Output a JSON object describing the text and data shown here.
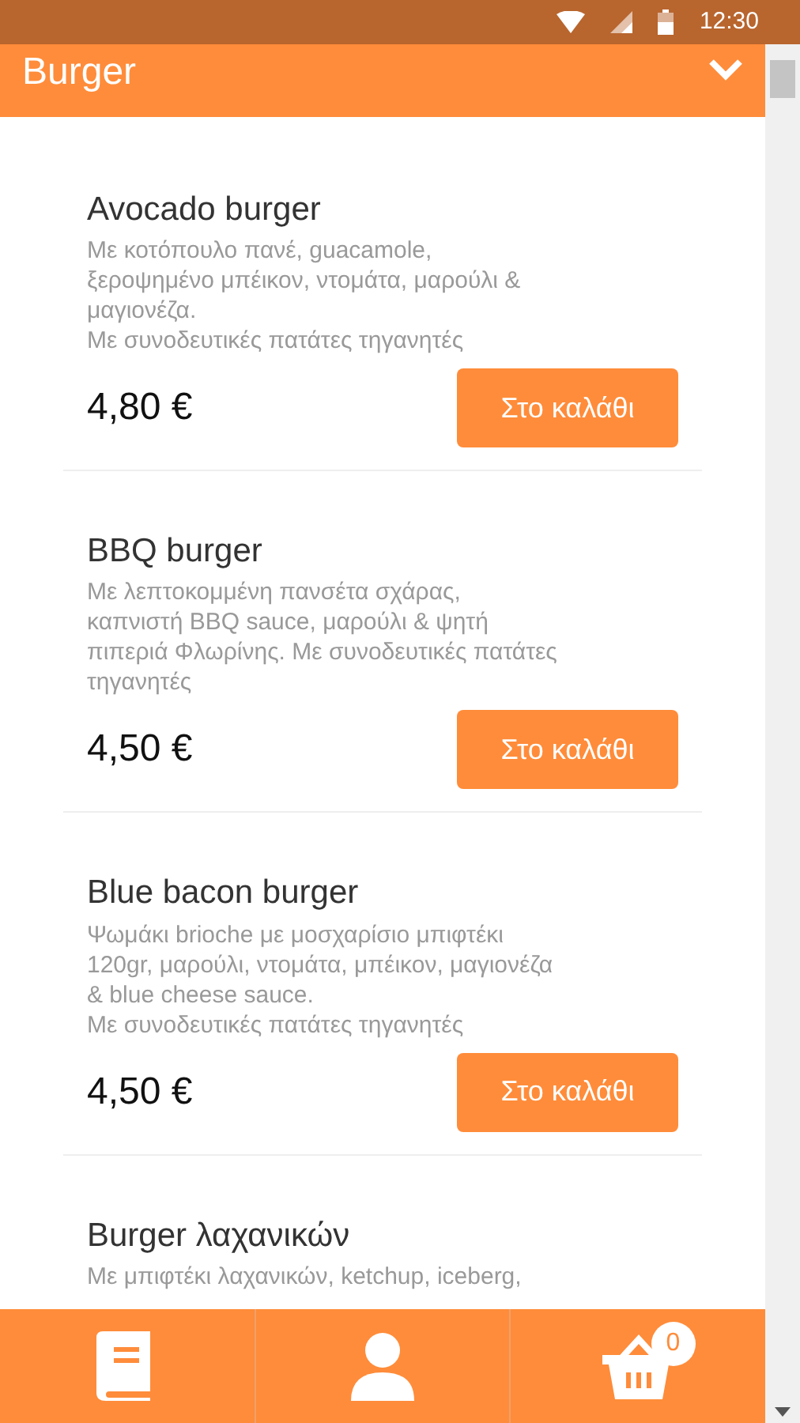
{
  "status_bar": {
    "time": "12:30"
  },
  "header": {
    "title": "Burger",
    "expanded": false
  },
  "items": [
    {
      "name": "Avocado burger",
      "description": "Με κοτόπουλο πανέ, guacamole, ξεροψημένο μπέικον, ντομάτα, μαρούλι & μαγιονέζα.\nΜε συνοδευτικές πατάτες τηγανητές",
      "price": "4,80 €",
      "button": "Στο καλάθι"
    },
    {
      "name": "BBQ burger",
      "description": "Με λεπτοκομμένη πανσέτα σχάρας, καπνιστή BBQ sauce, μαρούλι & ψητή πιπεριά Φλωρίνης. Με συνοδευτικές πατάτες τηγανητές",
      "price": "4,50 €",
      "button": "Στο καλάθι"
    },
    {
      "name": "Blue bacon burger",
      "description": "Ψωμάκι brioche με μοσχαρίσιο μπιφτέκι 120gr, μαρούλι, ντομάτα, μπέικον, μαγιονέζα & blue cheese sauce.\nΜε συνοδευτικές πατάτες τηγανητές",
      "price": "4,50 €",
      "button": "Στο καλάθι"
    },
    {
      "name": "Burger λαχανικών",
      "description": "Με μπιφτέκι λαχανικών, ketchup, iceberg,"
    }
  ],
  "bottom_nav": {
    "cart_count": "0"
  }
}
